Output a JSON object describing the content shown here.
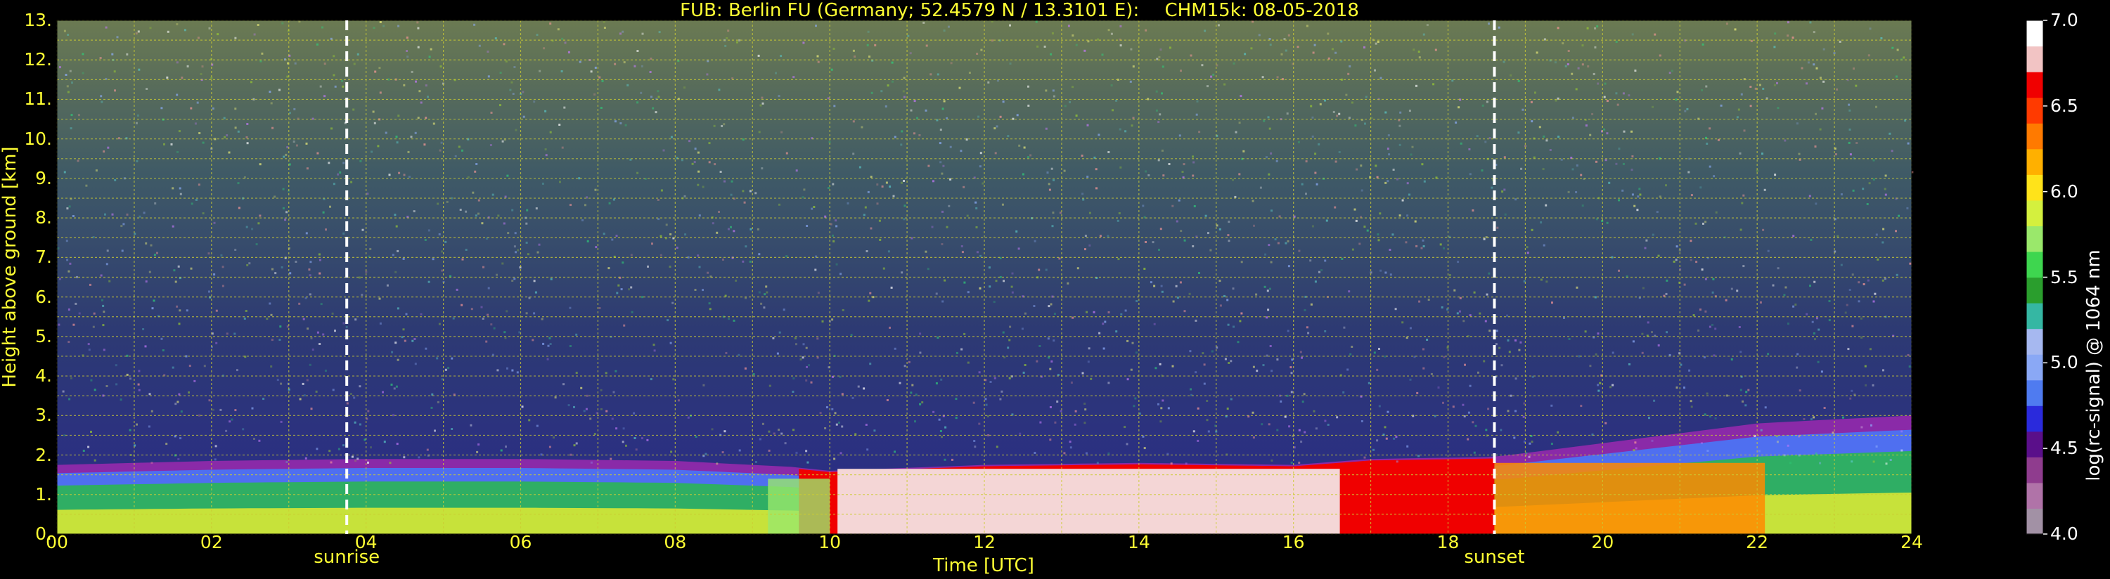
{
  "title": {
    "part1": "FUB: Berlin FU (Germany; 52.4579 N / 13.3101 E):",
    "part2": "CHM15k: 08-05-2018"
  },
  "chart_data": {
    "type": "heatmap",
    "xlabel": "Time [UTC]",
    "ylabel": "Height above ground [km]",
    "colorbar_label": "log(rc-signal) @ 1064 nm",
    "xlim": [
      0,
      24
    ],
    "ylim": [
      0,
      13
    ],
    "x_ticks": [
      "00",
      "02",
      "04",
      "06",
      "08",
      "10",
      "12",
      "14",
      "16",
      "18",
      "20",
      "22",
      "24"
    ],
    "y_ticks": [
      "0.",
      "1.",
      "2.",
      "3.",
      "4.",
      "5.",
      "6.",
      "7.",
      "8.",
      "9.",
      "10.",
      "11.",
      "12.",
      "13."
    ],
    "clim": [
      4.0,
      7.0
    ],
    "colorbar_ticks": [
      "4.0",
      "4.5",
      "5.0",
      "5.5",
      "6.0",
      "6.5",
      "7.0"
    ],
    "grid": true,
    "events": [
      {
        "name": "sunrise",
        "time": 3.75
      },
      {
        "name": "sunset",
        "time": 18.6
      }
    ],
    "boundary_layer_top_km": [
      [
        0,
        1.75
      ],
      [
        2,
        1.85
      ],
      [
        4,
        1.9
      ],
      [
        6,
        1.9
      ],
      [
        8,
        1.85
      ],
      [
        9.5,
        1.7
      ],
      [
        10,
        1.6
      ],
      [
        12,
        1.75
      ],
      [
        14,
        1.8
      ],
      [
        16,
        1.75
      ],
      [
        17,
        1.9
      ],
      [
        18.6,
        1.95
      ],
      [
        20,
        2.3
      ],
      [
        22,
        2.8
      ],
      [
        24,
        3.0
      ]
    ],
    "colors": {
      "axis_text": "#ffff33",
      "colorbar_text": "#ffffff",
      "grid": "#cccc33",
      "event_line": "#ffffff",
      "background": "#000000"
    },
    "colormap": [
      "#a291a5",
      "#b073a8",
      "#8f3c8e",
      "#5a0f8a",
      "#2a2adc",
      "#4f7bf0",
      "#8aa8f5",
      "#a6b8f0",
      "#35b7a3",
      "#2a9e2d",
      "#3ed64f",
      "#9ae86b",
      "#d4f03e",
      "#ffe31a",
      "#ffb000",
      "#ff7a00",
      "#ff3a00",
      "#f00000",
      "#f2c4c4",
      "#ffffff"
    ]
  }
}
